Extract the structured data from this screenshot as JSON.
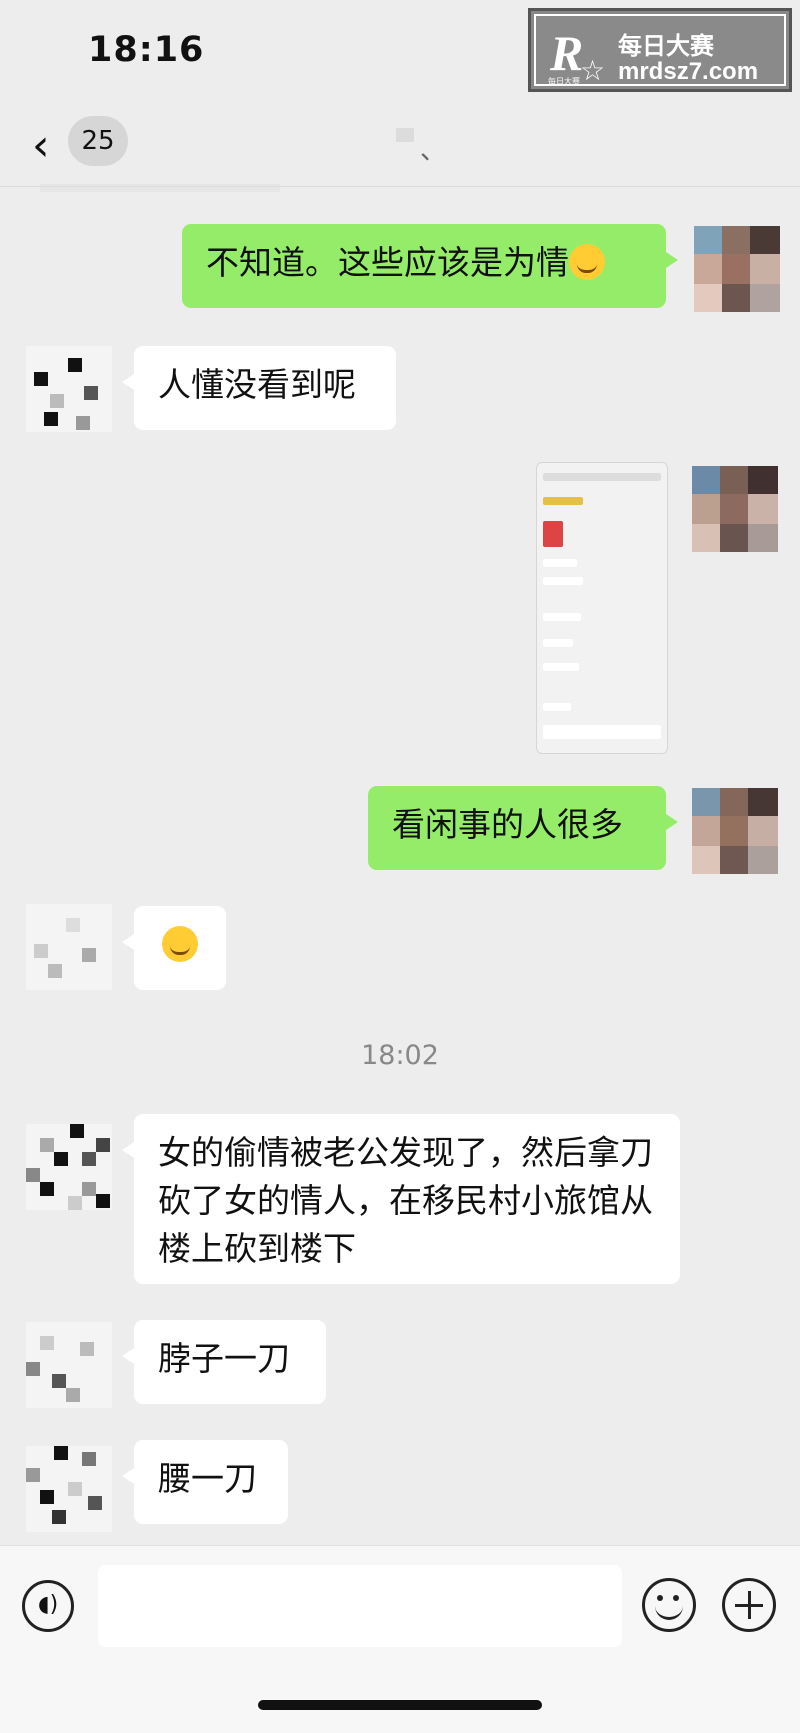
{
  "status_bar": {
    "time": "18:16"
  },
  "watermark": {
    "logo": "R",
    "logo_small": "每日大赛",
    "name": "每日大赛",
    "url": "mrdsz7.com"
  },
  "nav": {
    "back_count": "25",
    "title": "、"
  },
  "messages": [
    {
      "side": "out",
      "text": "不知道。这些应该是为情"
    },
    {
      "side": "in",
      "text": "人懂没看到呢"
    },
    {
      "side": "out",
      "type": "image"
    },
    {
      "side": "out",
      "text": "看闲事的人很多"
    },
    {
      "side": "in",
      "type": "emoji",
      "emoji": "face-with-tears-of-joy"
    },
    {
      "side": "in",
      "text": "女的偷情被老公发现了，然后拿刀砍了女的情人，在移民村小旅馆从楼上砍到楼下"
    },
    {
      "side": "in",
      "text": "脖子一刀"
    },
    {
      "side": "in",
      "text": "腰一刀"
    }
  ],
  "timestamp": "18:02",
  "input_bar": {
    "voice_icon": "voice-icon",
    "emoji_icon": "emoji-icon",
    "plus_icon": "plus-icon"
  },
  "colors": {
    "background": "#ededed",
    "outgoing_bubble": "#95ec69",
    "incoming_bubble": "#ffffff"
  }
}
